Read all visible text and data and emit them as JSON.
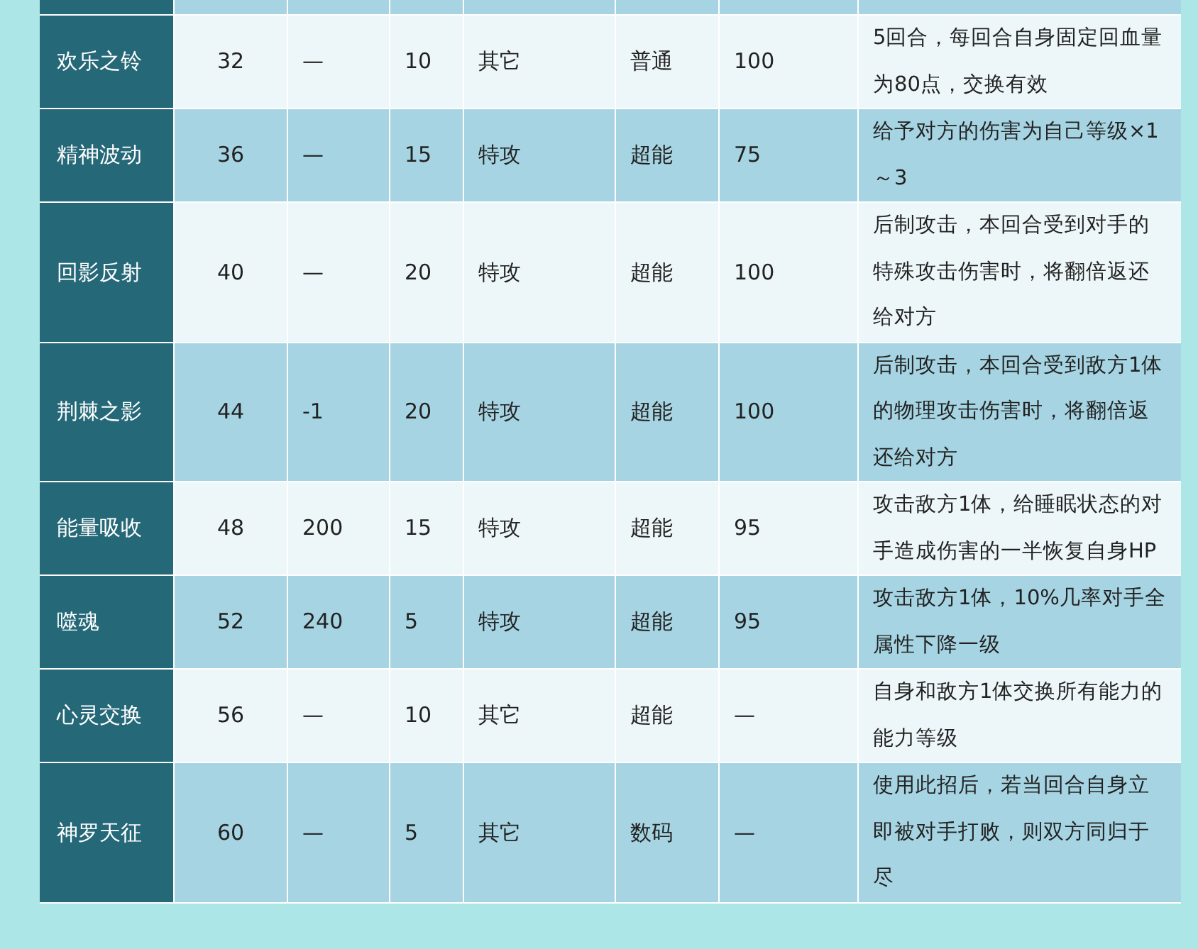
{
  "table": {
    "rows": [
      {
        "name": "欢乐之铃",
        "column_2": "32",
        "column_3": "—",
        "column_4": "10",
        "column_5": "其它",
        "column_6": "普通",
        "column_7": "100",
        "column_8": "5回合，每回合自身固定回血量为80点，交换有效"
      },
      {
        "name": "精神波动",
        "column_2": "36",
        "column_3": "—",
        "column_4": "15",
        "column_5": "特攻",
        "column_6": "超能",
        "column_7": "75",
        "column_8": "给予对方的伤害为自己等级×1～3"
      },
      {
        "name": "回影反射",
        "column_2": "40",
        "column_3": "—",
        "column_4": "20",
        "column_5": "特攻",
        "column_6": "超能",
        "column_7": "100",
        "column_8": "后制攻击，本回合受到对手的特殊攻击伤害时，将翻倍返还给对方"
      },
      {
        "name": "荆棘之影",
        "column_2": "44",
        "column_3": "-1",
        "column_4": "20",
        "column_5": "特攻",
        "column_6": "超能",
        "column_7": "100",
        "column_8": "后制攻击，本回合受到敌方1体的物理攻击伤害时，将翻倍返还给对方"
      },
      {
        "name": "能量吸收",
        "column_2": "48",
        "column_3": "200",
        "column_4": "15",
        "column_5": "特攻",
        "column_6": "超能",
        "column_7": "95",
        "column_8": "攻击敌方1体，给睡眠状态的对手造成伤害的一半恢复自身HP"
      },
      {
        "name": "噬魂",
        "column_2": "52",
        "column_3": "240",
        "column_4": "5",
        "column_5": "特攻",
        "column_6": "超能",
        "column_7": "95",
        "column_8": "攻击敌方1体，10%几率对手全属性下降一级"
      },
      {
        "name": "心灵交换",
        "column_2": "56",
        "column_3": "—",
        "column_4": "10",
        "column_5": "其它",
        "column_6": "超能",
        "column_7": "—",
        "column_8": "自身和敌方1体交换所有能力的能力等级"
      },
      {
        "name": "神罗天征",
        "column_2": "60",
        "column_3": "—",
        "column_4": "5",
        "column_5": "其它",
        "column_6": "数码",
        "column_7": "—",
        "column_8": "使用此招后，若当回合自身立即被对手打败，则双方同归于尽"
      }
    ]
  }
}
